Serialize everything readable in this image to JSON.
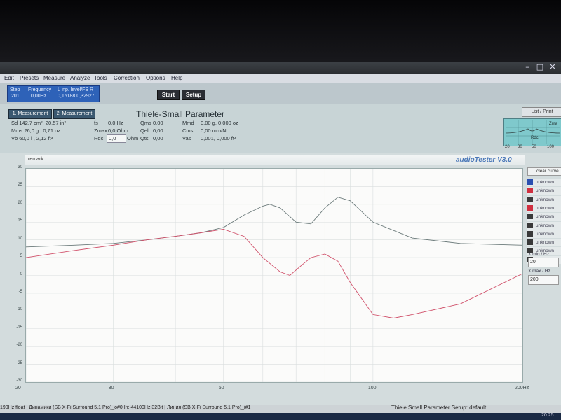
{
  "menu": [
    "Edit",
    "Presets",
    "Measure",
    "Analyze",
    "Tools",
    "Correction",
    "Options",
    "Help"
  ],
  "status_box": {
    "col1_label": "Step",
    "col1_value": "201",
    "col2_label": "Frequency",
    "col2_value": "0,00Hz",
    "col3_label": "L inp. level/FS R",
    "col3_value": "0,15188 0,32927"
  },
  "buttons": {
    "start": "Start",
    "setup": "Setup"
  },
  "tabs": [
    "1. Measurement",
    "2. Measurement"
  ],
  "ts": {
    "title": "Thiele-Small Parameter",
    "left": [
      "Sd   142,7 cm², 20,57 in²",
      "Mms   26,0 g   , 0,71 oz",
      "Vb    60,0 l   , 2,12 ft³"
    ],
    "mid_labels": [
      "fs",
      "Zmax",
      "Rdc"
    ],
    "mid_values": [
      "0,0 Hz",
      "0,0 Ohm",
      ""
    ],
    "rdc_value": "0,0",
    "rdc_unit": "Ohm",
    "q_labels": [
      "Qms",
      "Qel",
      "Qts"
    ],
    "q_values": [
      "0,00",
      "0,00",
      "0,00"
    ],
    "m_labels": [
      "Mmd",
      "Cms",
      "Vas"
    ],
    "m_values": [
      "0,00 g, 0,000 oz",
      "0,00 mm/N",
      "0,001, 0,000 ft³"
    ]
  },
  "list_print": "List / Print",
  "mini_axis": [
    "20",
    "30",
    "50",
    "100"
  ],
  "mini_labels": {
    "zma": "Zma",
    "rdc": "Rdc"
  },
  "remark": "remark",
  "brand": "audioTester  V3.0",
  "legend": {
    "clear": "clear curve",
    "items": [
      "unknown",
      "unknown",
      "unknown",
      "unknown",
      "unknown",
      "unknown",
      "unknown",
      "unknown",
      "unknown",
      "unknown"
    ]
  },
  "limits": {
    "xmin_label": "X min / Hz",
    "xmin_value": "20",
    "xmax_label": "X max / Hz",
    "xmax_value": "200"
  },
  "statusbar": {
    "left": "190Hz float  | Динамики (SB X-Fi Surround 5.1 Pro)_o#0  In: 44100Hz 32Bit  | Линия (SB X-Fi Surround 5.1 Pro)_i#1",
    "right": "Thiele Small Parameter  Setup: default"
  },
  "clock": "20:25",
  "colors": {
    "impedance": "#6b7a7a",
    "phase": "#d0506a"
  },
  "chart_data": {
    "type": "line",
    "xlabel": "",
    "ylabel": "",
    "xscale": "log",
    "xlim": [
      20,
      200
    ],
    "ylim": [
      -30,
      30
    ],
    "unit_y": "Ohm",
    "unit_x": "Hz",
    "x_ticks": [
      20,
      30,
      50,
      100,
      200
    ],
    "x_tick_labels": [
      "20",
      "30",
      "50",
      "100",
      "200Hz"
    ],
    "y_ticks": [
      30,
      25,
      20,
      15,
      10,
      5,
      0,
      -5,
      -10,
      -15,
      -20,
      -25,
      -30
    ],
    "grid": true,
    "series": [
      {
        "x": [
          20,
          25,
          30,
          35,
          40,
          45,
          50,
          55,
          60,
          62,
          65,
          70,
          75,
          80,
          85,
          90,
          100,
          120,
          150,
          200
        ],
        "y": [
          8,
          8.5,
          9,
          10,
          11,
          12,
          13.5,
          17,
          19.5,
          20,
          19,
          15,
          14.5,
          19,
          22,
          21,
          15,
          10.5,
          9,
          8.5
        ]
      },
      {
        "x": [
          20,
          25,
          30,
          35,
          40,
          45,
          50,
          55,
          60,
          65,
          68,
          72,
          75,
          80,
          85,
          90,
          100,
          110,
          120,
          150,
          200
        ],
        "y": [
          5,
          7,
          8.5,
          10,
          11,
          12,
          13,
          11,
          5,
          1,
          0,
          3,
          5,
          6,
          4,
          -2,
          -11,
          -12,
          -11,
          -8,
          0.5
        ]
      }
    ]
  }
}
